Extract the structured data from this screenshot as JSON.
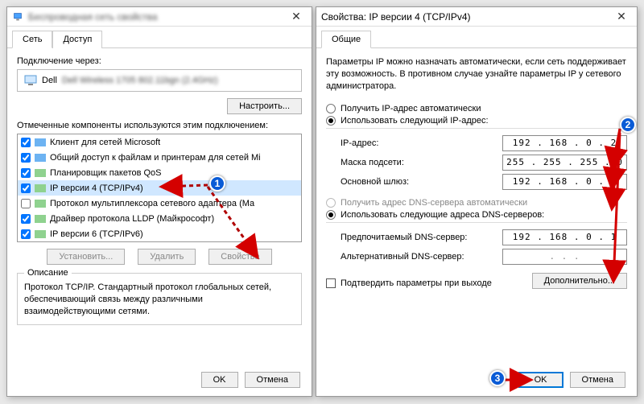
{
  "dlg1": {
    "title": "Беспроводная сеть свойства",
    "tabs": {
      "net": "Сеть",
      "access": "Доступ"
    },
    "conn_label": "Подключение через:",
    "conn_name": "Dell Wireless 1705 802.11bgn (2.4GHz)",
    "configure": "Настроить...",
    "components_label": "Отмеченные компоненты используются этим подключением:",
    "items": [
      {
        "checked": true,
        "label": "Клиент для сетей Microsoft"
      },
      {
        "checked": true,
        "label": "Общий доступ к файлам и принтерам для сетей Mi"
      },
      {
        "checked": true,
        "label": "Планировщик пакетов QoS"
      },
      {
        "checked": true,
        "label": "IP версии 4 (TCP/IPv4)"
      },
      {
        "checked": false,
        "label": "Протокол мультиплексора сетевого адаптера (Ма"
      },
      {
        "checked": true,
        "label": "Драйвер протокола LLDP (Майкрософт)"
      },
      {
        "checked": true,
        "label": "IP версии 6 (TCP/IPv6)"
      }
    ],
    "install": "Установить...",
    "remove": "Удалить",
    "props": "Свойства",
    "desc_title": "Описание",
    "desc_text": "Протокол TCP/IP. Стандартный протокол глобальных сетей, обеспечивающий связь между различными взаимодействующими сетями.",
    "ok": "OK",
    "cancel": "Отмена"
  },
  "dlg2": {
    "title": "Свойства: IP версии 4 (TCP/IPv4)",
    "tab": "Общие",
    "help": "Параметры IP можно назначать автоматически, если сеть поддерживает эту возможность. В противном случае узнайте параметры IP у сетевого администратора.",
    "ip_auto": "Получить IP-адрес автоматически",
    "ip_manual": "Использовать следующий IP-адрес:",
    "lbl_ip": "IP-адрес:",
    "val_ip": "192 . 168 .  0  .  2",
    "lbl_mask": "Маска подсети:",
    "val_mask": "255 . 255 . 255 .  0",
    "lbl_gw": "Основной шлюз:",
    "val_gw": "192 . 168 .  0  .  1",
    "dns_auto": "Получить адрес DNS-сервера автоматически",
    "dns_manual": "Использовать следующие адреса DNS-серверов:",
    "lbl_dns1": "Предпочитаемый DNS-сервер:",
    "val_dns1": "192 . 168 .  0  .  1",
    "lbl_dns2": "Альтернативный DNS-сервер:",
    "val_dns2": ".       .       .",
    "confirm": "Подтвердить параметры при выходе",
    "advanced": "Дополнительно...",
    "ok": "OK",
    "cancel": "Отмена"
  },
  "markers": {
    "m1": "1",
    "m2": "2",
    "m3": "3"
  }
}
